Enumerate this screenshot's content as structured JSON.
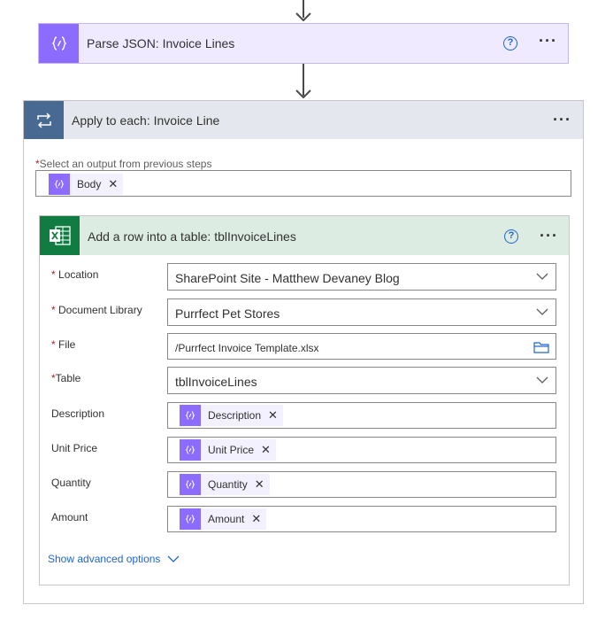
{
  "parse_step": {
    "title": "Parse JSON: Invoice Lines"
  },
  "apply_step": {
    "title": "Apply to each: Invoice Line",
    "select_label": "Select an output from previous steps",
    "select_token": "Body"
  },
  "excel_step": {
    "title": "Add a row into a table: tblInvoiceLines",
    "fields": {
      "location": {
        "label": "Location",
        "value": "SharePoint Site - Matthew Devaney Blog"
      },
      "document_library": {
        "label": "Document Library",
        "value": "Purrfect Pet Stores"
      },
      "file": {
        "label": "File",
        "value": "/Purrfect Invoice Template.xlsx"
      },
      "table": {
        "label": "Table",
        "value": "tblInvoiceLines"
      },
      "description": {
        "label": "Description",
        "token": "Description"
      },
      "unit_price": {
        "label": "Unit Price",
        "token": "Unit Price"
      },
      "quantity": {
        "label": "Quantity",
        "token": "Quantity"
      },
      "amount": {
        "label": "Amount",
        "token": "Amount"
      }
    },
    "advanced_link": "Show advanced options"
  },
  "icons": {
    "parse": "json-expression-icon",
    "loop": "loop-icon",
    "excel": "excel-icon",
    "help": "help-icon",
    "more": "more-options-icon"
  },
  "colors": {
    "parse_accent": "#8c6cff",
    "loop_accent": "#486991",
    "excel_accent": "#107c41",
    "link": "#2065d1",
    "required": "#a4262c"
  }
}
